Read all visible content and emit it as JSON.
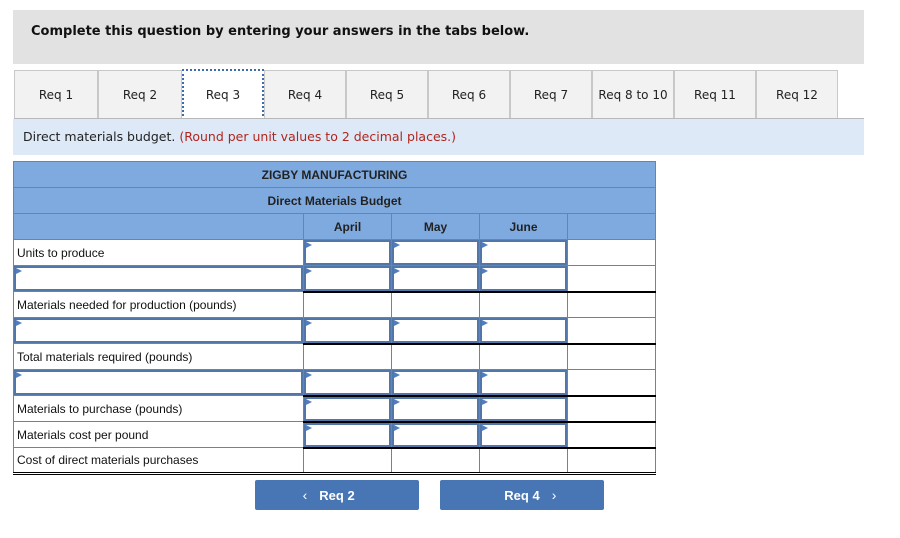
{
  "instructions": "Complete this question by entering your answers in the tabs below.",
  "tabs": [
    {
      "label": "Req 1",
      "active": false
    },
    {
      "label": "Req 2",
      "active": false
    },
    {
      "label": "Req 3",
      "active": true
    },
    {
      "label": "Req 4",
      "active": false
    },
    {
      "label": "Req 5",
      "active": false
    },
    {
      "label": "Req 6",
      "active": false
    },
    {
      "label": "Req 7",
      "active": false
    },
    {
      "label": "Req 8 to 10",
      "active": false
    },
    {
      "label": "Req 11",
      "active": false
    },
    {
      "label": "Req 12",
      "active": false
    }
  ],
  "subtitle": {
    "text": "Direct materials budget.",
    "note": "(Round per unit values to 2 decimal places.)"
  },
  "budget": {
    "company": "ZIGBY MANUFACTURING",
    "title": "Direct Materials Budget",
    "columns": [
      "April",
      "May",
      "June"
    ],
    "rows": [
      {
        "label": "Units to produce",
        "label_input": false,
        "values": [
          "",
          "",
          ""
        ],
        "inputs": true
      },
      {
        "label": "",
        "label_input": true,
        "values": [
          "",
          "",
          ""
        ],
        "inputs": true
      },
      {
        "label": "Materials needed for production (pounds)",
        "label_input": false,
        "values": [
          "",
          "",
          ""
        ],
        "inputs": false
      },
      {
        "label": "",
        "label_input": true,
        "values": [
          "",
          "",
          ""
        ],
        "inputs": true
      },
      {
        "label": "Total materials required (pounds)",
        "label_input": false,
        "values": [
          "",
          "",
          ""
        ],
        "inputs": false
      },
      {
        "label": "",
        "label_input": true,
        "values": [
          "",
          "",
          ""
        ],
        "inputs": true
      },
      {
        "label": "Materials to purchase (pounds)",
        "label_input": false,
        "values": [
          "",
          "",
          ""
        ],
        "inputs": true
      },
      {
        "label": "Materials cost per pound",
        "label_input": false,
        "values": [
          "",
          "",
          ""
        ],
        "inputs": true
      },
      {
        "label": "Cost of direct materials purchases",
        "label_input": false,
        "values": [
          "",
          "",
          ""
        ],
        "inputs": false
      }
    ]
  },
  "nav": {
    "prev_label": "Req 2",
    "next_label": "Req 4",
    "prev_icon": "chevron-left-icon",
    "next_icon": "chevron-right-icon"
  }
}
